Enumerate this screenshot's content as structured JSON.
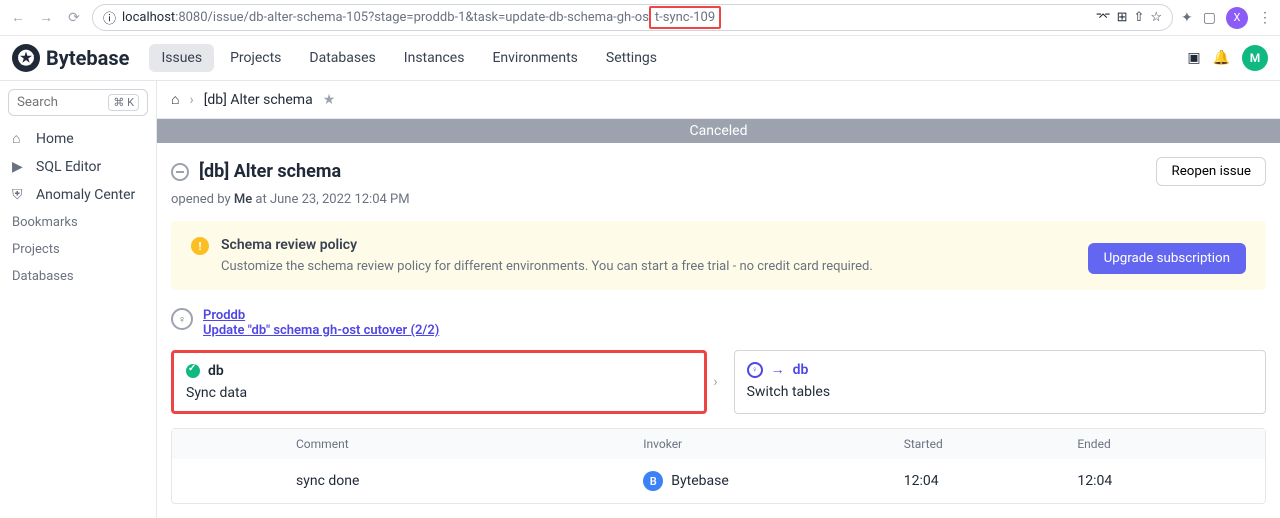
{
  "browser": {
    "url_prefix": "localhost",
    "url_port_path": ":8080/issue/db-alter-schema-105?stage=proddb-1&task=update-db-schema-gh-os",
    "url_highlighted": "t-sync-109",
    "avatar_letter": "X"
  },
  "logo": "Bytebase",
  "nav": {
    "issues": "Issues",
    "projects": "Projects",
    "databases": "Databases",
    "instances": "Instances",
    "environments": "Environments",
    "settings": "Settings"
  },
  "header_avatar": "M",
  "search": {
    "placeholder": "Search",
    "shortcut": "⌘ K"
  },
  "sidebar": {
    "home": "Home",
    "sql_editor": "SQL Editor",
    "anomaly": "Anomaly Center",
    "bookmarks": "Bookmarks",
    "projects": "Projects",
    "databases": "Databases"
  },
  "breadcrumb": {
    "title": "[db] Alter schema"
  },
  "status_banner": "Canceled",
  "issue": {
    "title": "[db] Alter schema",
    "reopen": "Reopen issue",
    "opened_by": "opened by ",
    "me": "Me",
    "at": " at June 23, 2022 12:04 PM"
  },
  "schema_notice": {
    "title": "Schema review policy",
    "desc": "Customize the schema review policy for different environments. You can start a free trial - no credit card required.",
    "button": "Upgrade subscription"
  },
  "stage": {
    "env": "Proddb",
    "task": "Update \"db\" schema gh-ost cutover (2/2)"
  },
  "cards": {
    "left": {
      "db": "db",
      "name": "Sync data"
    },
    "right": {
      "db": "db",
      "name": "Switch tables"
    }
  },
  "table": {
    "headers": {
      "comment": "Comment",
      "invoker": "Invoker",
      "started": "Started",
      "ended": "Ended"
    },
    "row": {
      "comment": "sync done",
      "invoker": "Bytebase",
      "invoker_badge": "B",
      "started": "12:04",
      "ended": "12:04"
    }
  }
}
